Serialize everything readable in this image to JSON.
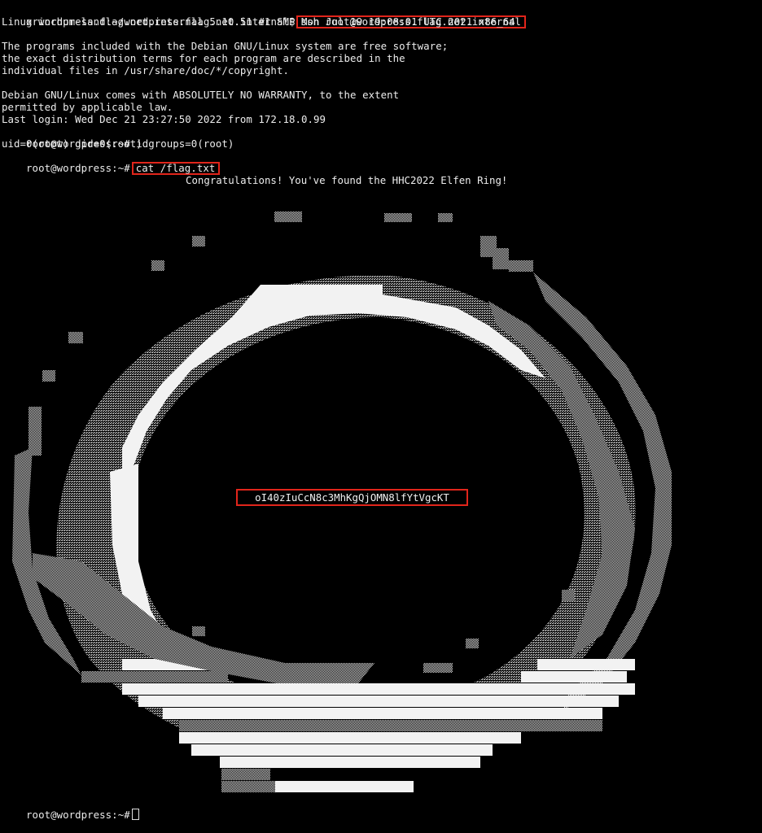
{
  "terminal": {
    "prompt_local": "grinchum-land:~/wordpress.flag.net.internal$",
    "ssh_command": "ssh root@wordpress.flag.net.internal",
    "uname_line": "Linux wordpress.flag.net.internal 5.10.51 #1 SMP Mon Jul 19 19:08:01 UTC 2021 x86_64",
    "motd": [
      "The programs included with the Debian GNU/Linux system are free software;",
      "the exact distribution terms for each program are described in the",
      "individual files in /usr/share/doc/*/copyright.",
      "Debian GNU/Linux comes with ABSOLUTELY NO WARRANTY, to the extent",
      "permitted by applicable law."
    ],
    "last_login": "Last login: Wed Dec 21 23:27:50 2022 from 172.18.0.99",
    "prompt_remote": "root@wordpress:~#",
    "cmd_id": "id",
    "id_output": "uid=0(root) gid=0(root) groups=0(root)",
    "cmd_cat": "cat /flag.txt",
    "congrats": "Congratulations! You've found the HHC2022 Elfen Ring!",
    "flag": "oI40zIuCcN8c3MhKgQjOMN8lfYtVgcKT",
    "final_prompt": "root@wordpress:~#"
  },
  "colors": {
    "background": "#000000",
    "text": "#ececec",
    "highlight_box": "#e1251b",
    "ring_solid": "#f2f2f2",
    "ring_shade": "#9a9a9a"
  }
}
